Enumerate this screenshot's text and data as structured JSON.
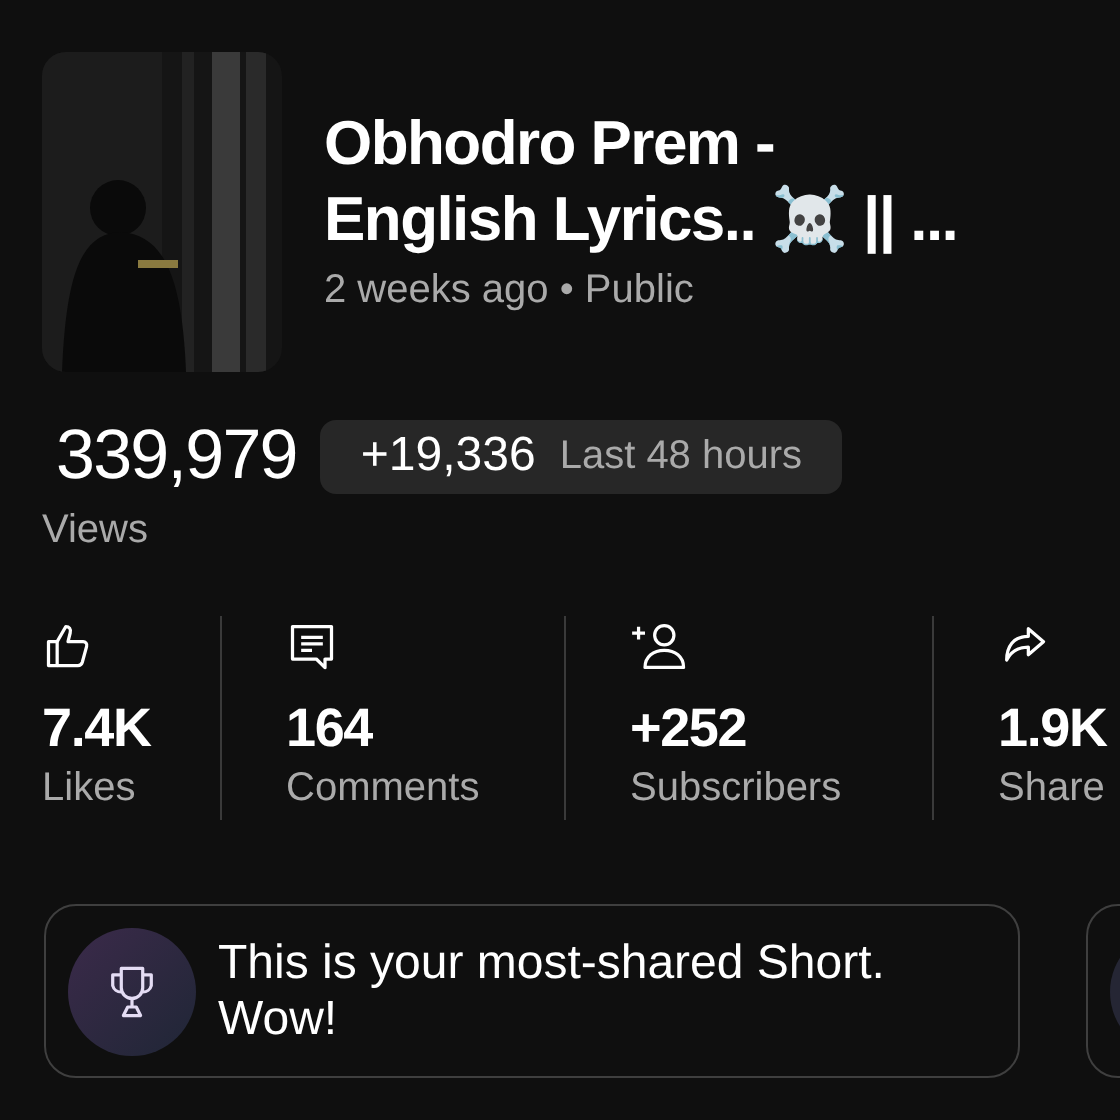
{
  "video": {
    "title": "Obhodro Prem - English Lyrics.. ☠️ || ...",
    "meta": "2 weeks ago • Public"
  },
  "views": {
    "count": "339,979",
    "change": "+19,336",
    "period": "Last 48 hours",
    "label": "Views"
  },
  "stats": [
    {
      "kind": "likes",
      "value": "7.4K",
      "label": "Likes"
    },
    {
      "kind": "comments",
      "value": "164",
      "label": "Comments"
    },
    {
      "kind": "subscribers",
      "value": "+252",
      "label": "Subscribers"
    },
    {
      "kind": "shares",
      "value": "1.9K",
      "label": "Share"
    }
  ],
  "highlight": {
    "kind": "trophy",
    "text": "This is your most-shared Short. Wow!"
  }
}
